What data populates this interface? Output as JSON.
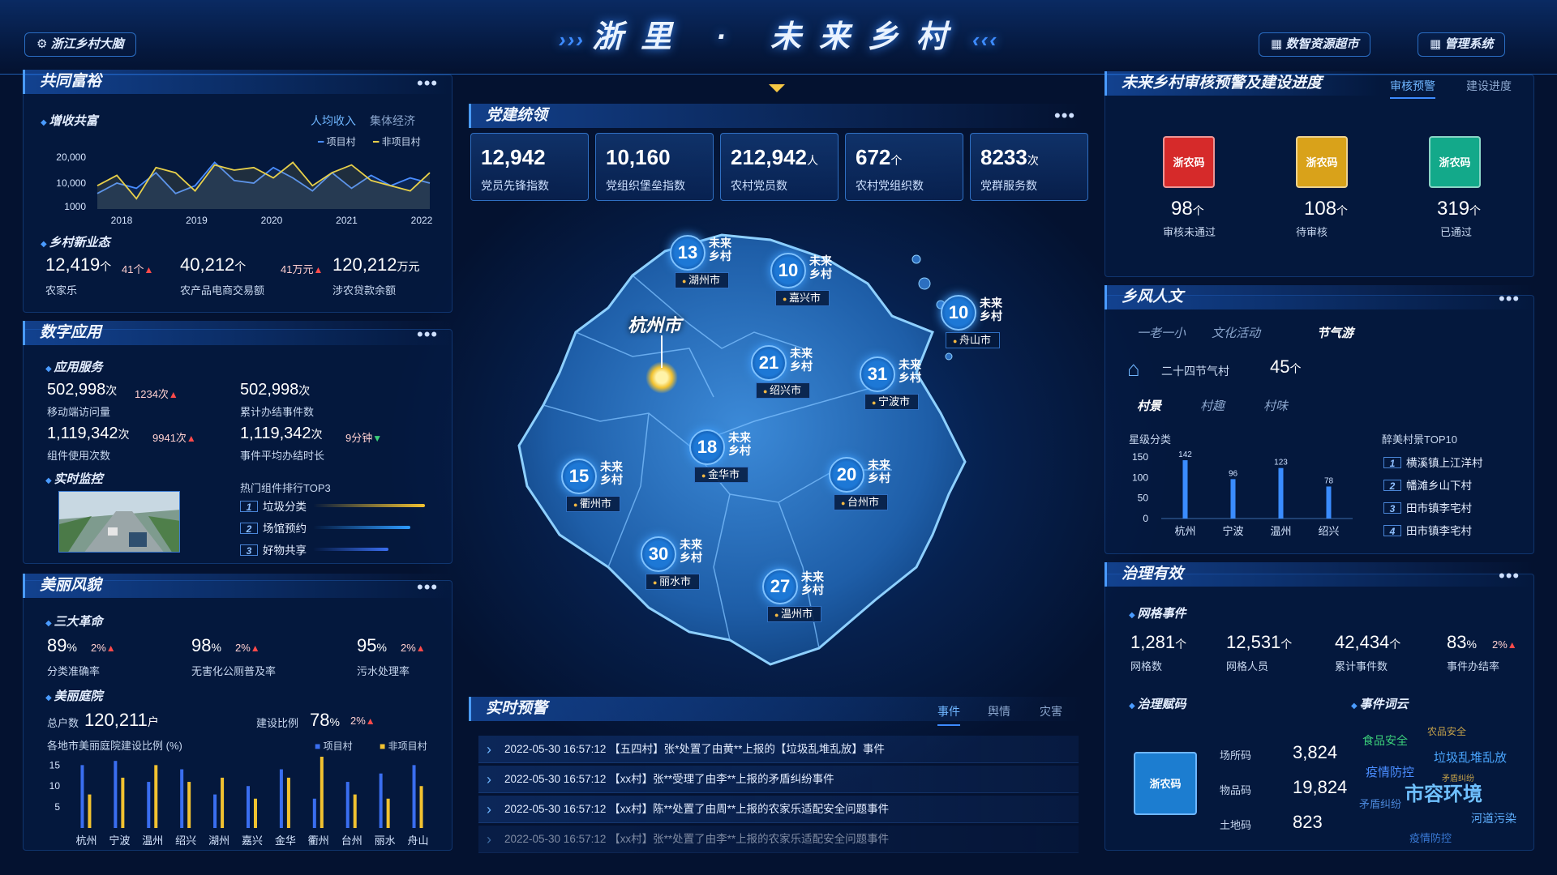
{
  "header": {
    "title": "浙里 · 未来乡村",
    "left_label": "浙江乡村大脑",
    "right_label_1": "数智资源超市",
    "right_label_2": "管理系统"
  },
  "common_prosperity": {
    "title": "共同富裕",
    "income": {
      "subtitle": "增收共富",
      "tab_active": "人均收入",
      "tab_inactive": "集体经济",
      "legend_a": "项目村",
      "legend_b": "非项目村",
      "y_ticks": [
        "20,000",
        "10,000",
        "1000"
      ],
      "x_ticks": [
        "2018",
        "2019",
        "2020",
        "2021",
        "2022"
      ]
    },
    "new_business": {
      "subtitle": "乡村新业态",
      "items": [
        {
          "value": "12,419",
          "unit": "个",
          "delta": "41个",
          "label": "农家乐"
        },
        {
          "value": "40,212",
          "unit": "个",
          "delta": "41万元",
          "label": "农产品电商交易额"
        },
        {
          "value": "120,212",
          "unit": "万元",
          "delta": "",
          "label": "涉农贷款余额"
        }
      ]
    }
  },
  "digital_apps": {
    "title": "数字应用",
    "service_subtitle": "应用服务",
    "stats": [
      {
        "value": "502,998",
        "unit": "次",
        "delta": "1234次",
        "label": "移动端访问量"
      },
      {
        "value": "502,998",
        "unit": "次",
        "delta": "",
        "label": "累计办结事件数"
      },
      {
        "value": "1,119,342",
        "unit": "次",
        "delta": "9941次",
        "label": "组件使用次数"
      },
      {
        "value": "1,119,342",
        "unit": "次",
        "delta": "9分钟",
        "label": "事件平均办结时长"
      }
    ],
    "monitor_subtitle": "实时监控",
    "top3_title": "热门组件排行TOP3",
    "top3": [
      {
        "rank": "1",
        "name": "垃圾分类",
        "fill": 0.92
      },
      {
        "rank": "2",
        "name": "场馆预约",
        "fill": 0.8
      },
      {
        "rank": "3",
        "name": "好物共享",
        "fill": 0.62
      }
    ]
  },
  "beauty": {
    "title": "美丽风貌",
    "revolution_subtitle": "三大革命",
    "revolution": [
      {
        "value": "89",
        "unit": "%",
        "delta": "2%",
        "label": "分类准确率"
      },
      {
        "value": "98",
        "unit": "%",
        "delta": "2%",
        "label": "无害化公厕普及率"
      },
      {
        "value": "95",
        "unit": "%",
        "delta": "2%",
        "label": "污水处理率"
      }
    ],
    "garden_subtitle": "美丽庭院",
    "total_label": "总户数",
    "total_value": "120,211",
    "total_unit": "户",
    "ratio_label": "建设比例",
    "ratio_value": "78",
    "ratio_unit": "%",
    "ratio_delta": "2%",
    "chart_title": "各地市美丽庭院建设比例 (%)",
    "legend_a": "项目村",
    "legend_b": "非项目村",
    "y_ticks": [
      "15",
      "10",
      "5"
    ]
  },
  "party": {
    "title": "党建统领",
    "kpis": [
      {
        "value": "12,942",
        "unit": "",
        "label": "党员先锋指数"
      },
      {
        "value": "10,160",
        "unit": "",
        "label": "党组织堡垒指数"
      },
      {
        "value": "212,942",
        "unit": "人",
        "label": "农村党员数"
      },
      {
        "value": "672",
        "unit": "个",
        "label": "农村党组织数"
      },
      {
        "value": "8233",
        "unit": "次",
        "label": "党群服务数"
      }
    ]
  },
  "map": {
    "capital": "杭州市",
    "suffix": "未来 乡村",
    "pins": [
      {
        "num": "13",
        "name": "湖州市"
      },
      {
        "num": "10",
        "name": "嘉兴市"
      },
      {
        "num": "10",
        "name": "舟山市"
      },
      {
        "num": "21",
        "name": "绍兴市"
      },
      {
        "num": "31",
        "name": "宁波市"
      },
      {
        "num": "18",
        "name": "金华市"
      },
      {
        "num": "15",
        "name": "衢州市"
      },
      {
        "num": "20",
        "name": "台州市"
      },
      {
        "num": "30",
        "name": "丽水市"
      },
      {
        "num": "27",
        "name": "温州市"
      }
    ]
  },
  "alerts": {
    "title": "实时预警",
    "tabs": [
      "事件",
      "舆情",
      "灾害"
    ],
    "rows": [
      "2022-05-30 16:57:12    【五四村】张*处置了由黄**上报的【垃圾乱堆乱放】事件",
      "2022-05-30 16:57:12    【xx村】张**受理了由李**上报的矛盾纠纷事件",
      "2022-05-30 16:57:12    【xx村】陈**处置了由周**上报的农家乐适配安全问题事件",
      "2022-05-30 16:57:12    【xx村】张**处置了由李**上报的农家乐适配安全问题事件"
    ]
  },
  "audit": {
    "title": "未来乡村审核预警及建设进度",
    "tab_active": "审核预警",
    "tab_inactive": "建设进度",
    "codes": [
      {
        "label": "浙农码",
        "value": "98",
        "unit": "个",
        "caption": "审核未通过",
        "color": "#d62a2a"
      },
      {
        "label": "浙农码",
        "value": "108",
        "unit": "个",
        "caption": "待审核",
        "color": "#d9a21a"
      },
      {
        "label": "浙农码",
        "value": "319",
        "unit": "个",
        "caption": "已通过",
        "color": "#13a98a"
      }
    ]
  },
  "culture": {
    "title": "乡风人文",
    "tabs": [
      "一老一小",
      "文化活动",
      "节气游"
    ],
    "solar_label": "二十四节气村",
    "solar_value": "45",
    "solar_unit": "个",
    "scene_tabs": [
      "村景",
      "村趣",
      "村味"
    ],
    "star_title": "星级分类",
    "top10_title": "醉美村景TOP10",
    "top10": [
      {
        "rank": "1",
        "name": "横溪镇上江洋村"
      },
      {
        "rank": "2",
        "name": "幡滩乡山下村"
      },
      {
        "rank": "3",
        "name": "田市镇李宅村"
      },
      {
        "rank": "4",
        "name": "田市镇李宅村"
      }
    ]
  },
  "governance": {
    "title": "治理有效",
    "grid_subtitle": "网格事件",
    "stats": [
      {
        "value": "1,281",
        "unit": "个",
        "delta": "",
        "label": "网格数"
      },
      {
        "value": "12,531",
        "unit": "个",
        "delta": "",
        "label": "网格人员"
      },
      {
        "value": "42,434",
        "unit": "个",
        "delta": "",
        "label": "累计事件数"
      },
      {
        "value": "83",
        "unit": "%",
        "delta": "2%",
        "label": "事件办结率"
      }
    ],
    "code_subtitle": "治理赋码",
    "code_label": "浙农码",
    "codes": [
      {
        "label": "场所码",
        "value": "3,824"
      },
      {
        "label": "物品码",
        "value": "19,824"
      },
      {
        "label": "土地码",
        "value": "823"
      }
    ],
    "cloud_subtitle": "事件词云",
    "cloud": [
      {
        "text": "食品安全",
        "color": "#3ccf7a"
      },
      {
        "text": "农品安全",
        "color": "#c2a04a"
      },
      {
        "text": "垃圾乱堆乱放",
        "color": "#4aa6ff"
      },
      {
        "text": "疫情防控",
        "color": "#4a8dff"
      },
      {
        "text": "矛盾纠纷",
        "color": "#4a86d8"
      },
      {
        "text": "市容环境",
        "color": "#6fc0ff"
      },
      {
        "text": "矛盾纠纷",
        "color": "#c2a04a"
      },
      {
        "text": "河道污染",
        "color": "#5fb0ff"
      },
      {
        "text": "疫情防控",
        "color": "#3a7ad6"
      }
    ]
  },
  "chart_data": [
    {
      "type": "line",
      "title": "增收共富",
      "x": [
        "2018",
        "",
        "",
        "",
        "2019",
        "",
        "",
        "",
        "2020",
        "",
        "",
        "",
        "2021",
        "",
        "",
        "",
        "2022",
        ""
      ],
      "ylim": [
        0,
        25000
      ],
      "series": [
        {
          "name": "项目村",
          "values": [
            6000,
            10000,
            8000,
            14000,
            6000,
            9000,
            18000,
            11000,
            10000,
            16000,
            12000,
            7000,
            14000,
            8000,
            13000,
            9000,
            12000,
            10000
          ]
        },
        {
          "name": "非项目村",
          "values": [
            9000,
            13000,
            4000,
            16000,
            14000,
            7000,
            17000,
            15000,
            16000,
            12000,
            18000,
            9000,
            14000,
            17000,
            11000,
            9000,
            7000,
            14000
          ]
        }
      ]
    },
    {
      "type": "bar",
      "title": "各地市美丽庭院建设比例 (%)",
      "categories": [
        "杭州",
        "宁波",
        "温州",
        "绍兴",
        "湖州",
        "嘉兴",
        "金华",
        "衢州",
        "台州",
        "丽水",
        "舟山"
      ],
      "ylim": [
        0,
        17
      ],
      "series": [
        {
          "name": "项目村",
          "values": [
            15,
            16,
            11,
            14,
            8,
            10,
            14,
            7,
            11,
            13,
            15
          ]
        },
        {
          "name": "非项目村",
          "values": [
            8,
            12,
            15,
            11,
            12,
            7,
            12,
            17,
            8,
            7,
            10
          ]
        }
      ]
    },
    {
      "type": "bar",
      "title": "星级分类",
      "categories": [
        "杭州",
        "宁波",
        "温州",
        "绍兴"
      ],
      "yticks": [
        "150",
        "100",
        "50",
        "0"
      ],
      "ylim": [
        0,
        150
      ],
      "values": [
        142,
        96,
        123,
        78
      ]
    }
  ]
}
